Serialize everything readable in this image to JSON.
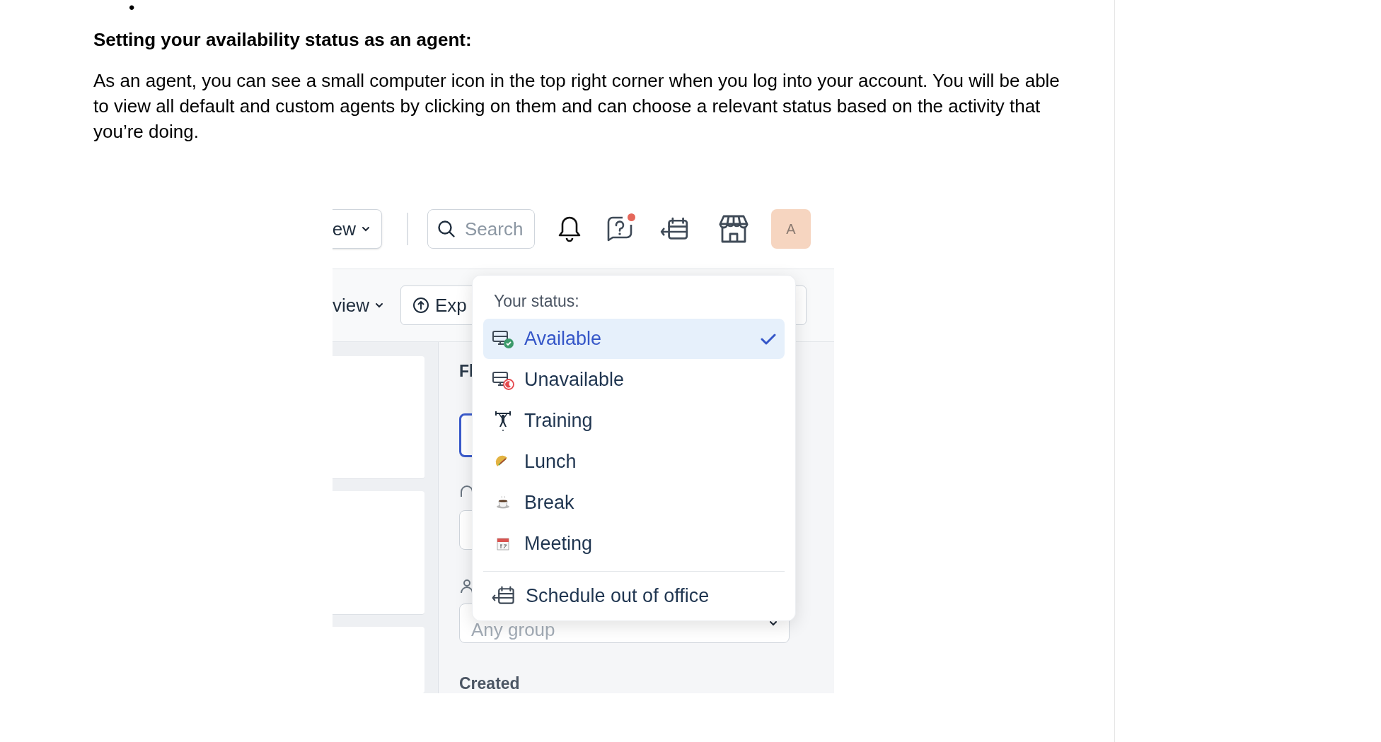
{
  "doc": {
    "bullet": "•",
    "heading": "Setting your availability status as an agent:",
    "paragraph": "As an agent, you can see a small computer icon in the top right corner when you log into your account. You will be able to view all default and custom agents by clicking on them and can choose a relevant status based on the activity that you’re doing."
  },
  "screenshot": {
    "top_bar": {
      "view_button": "ew",
      "search_placeholder": "Search",
      "help_notification": true,
      "avatar": "A"
    },
    "toolbar": {
      "view_button": "view",
      "export_button": "Exp"
    },
    "filter_panel": {
      "heading": "Fl",
      "group_placeholder": "Any group",
      "created_label": "Created"
    },
    "status_menu": {
      "title": "Your status:",
      "items": [
        {
          "label": "Available",
          "kind": "available",
          "selected": true
        },
        {
          "label": "Unavailable",
          "kind": "unavailable",
          "selected": false
        },
        {
          "label": "Training",
          "kind": "training",
          "selected": false
        },
        {
          "label": "Lunch",
          "kind": "lunch",
          "selected": false
        },
        {
          "label": "Break",
          "kind": "break",
          "selected": false
        },
        {
          "label": "Meeting",
          "kind": "meeting",
          "selected": false
        }
      ],
      "action": "Schedule out of office"
    }
  }
}
